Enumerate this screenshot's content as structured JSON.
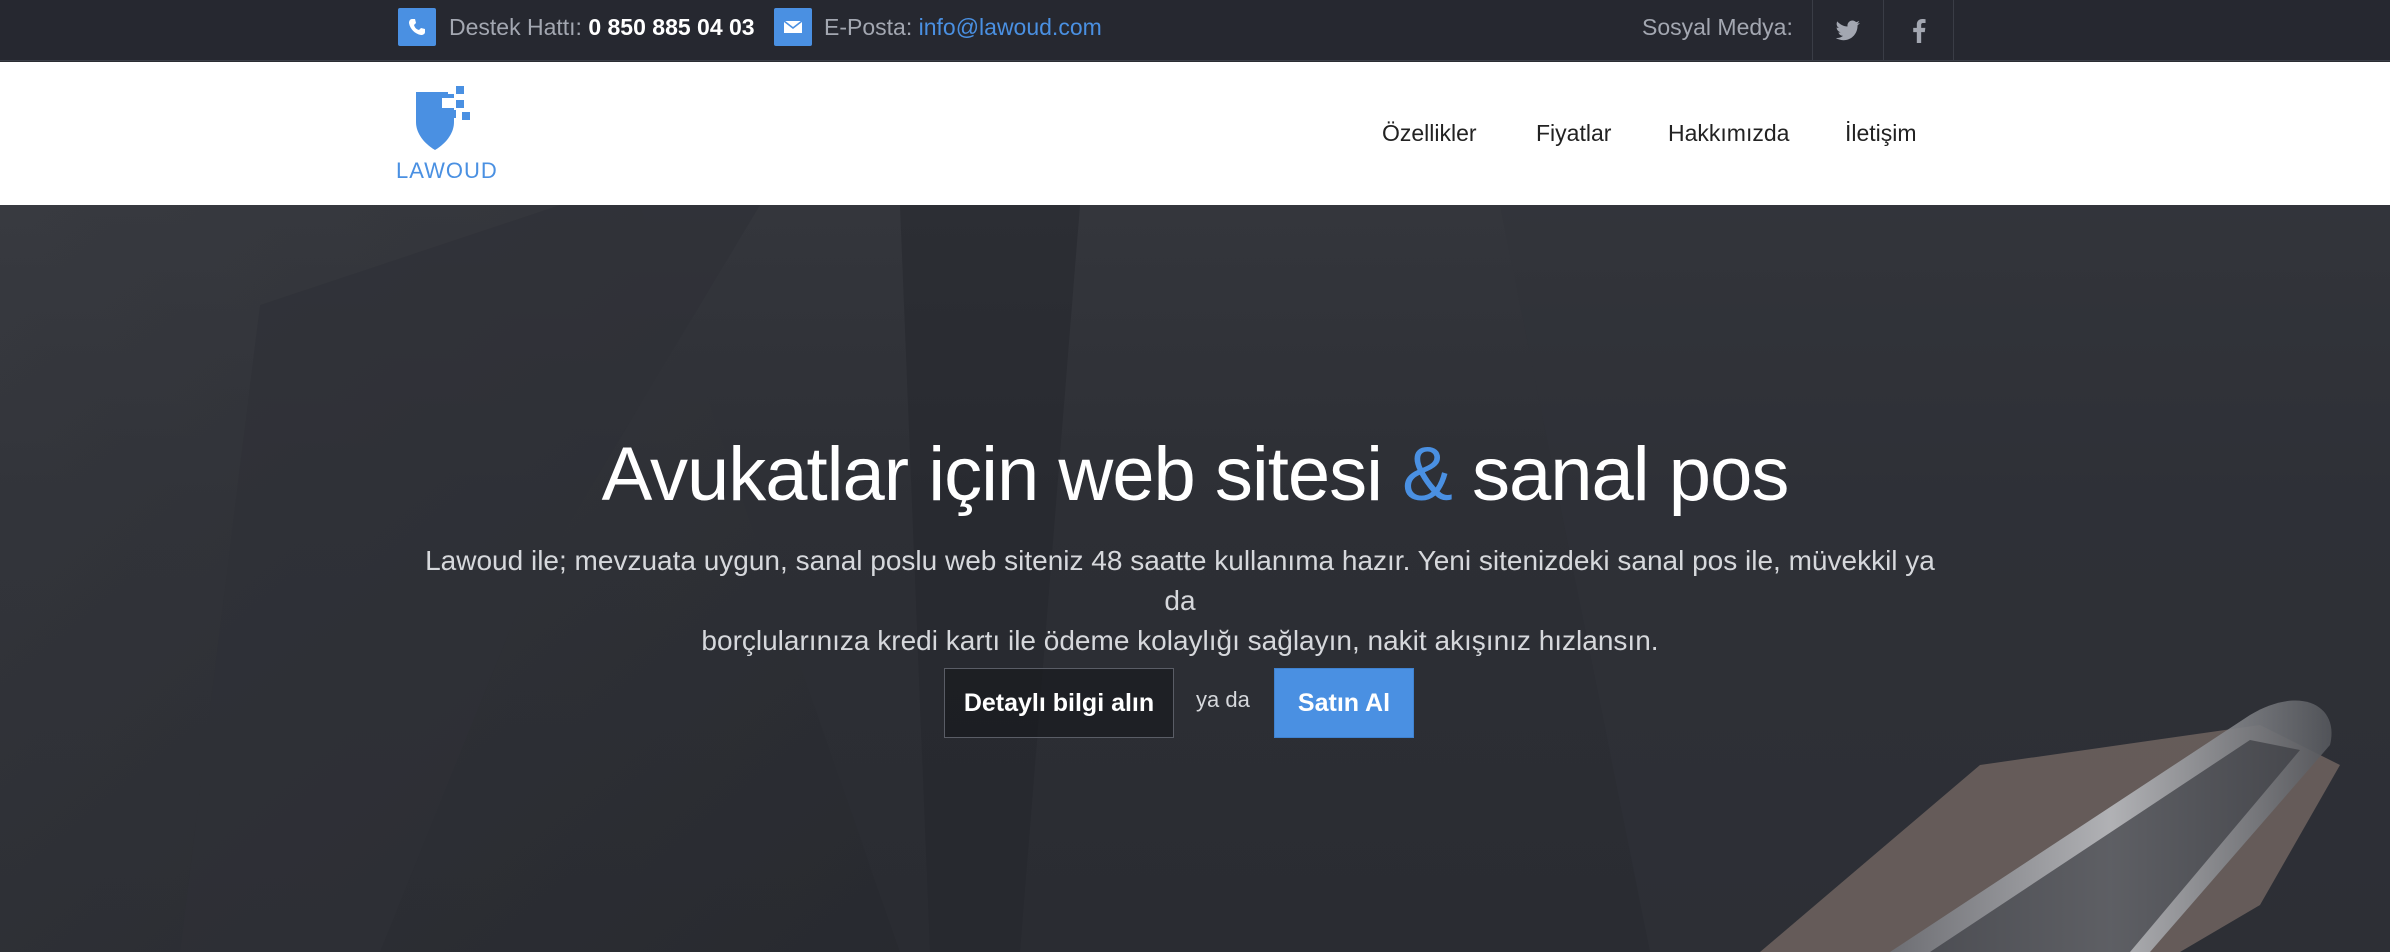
{
  "topbar": {
    "phone_label": "Destek Hattı:",
    "phone_number": "0 850 885 04 03",
    "email_label": "E-Posta:",
    "email_value": "info@lawoud.com",
    "social_label": "Sosyal Medya:",
    "icons": [
      "phone-icon",
      "mail-icon",
      "twitter-icon",
      "facebook-icon"
    ]
  },
  "header": {
    "logo_text": "LAWOUD",
    "nav": [
      "Özellikler",
      "Fiyatlar",
      "Hakkımızda",
      "İletişim"
    ]
  },
  "hero": {
    "title_part1": "Avukatlar için web sitesi",
    "title_amp": "&",
    "title_part2": "sanal pos",
    "subtitle_line1": "Lawoud ile; mevzuata uygun, sanal poslu web siteniz 48 saatte kullanıma hazır. Yeni sitenizdeki sanal pos ile, müvekkil ya da",
    "subtitle_line2": "borçlularınıza kredi kartı ile ödeme kolaylığı sağlayın, nakit akışınız hızlansın.",
    "btn_info": "Detaylı bilgi alın",
    "or_text": "ya da",
    "btn_buy": "Satın Al"
  },
  "colors": {
    "accent": "#4a90e2",
    "topbar_bg": "#262830",
    "hero_bg": "#2b2d33"
  }
}
